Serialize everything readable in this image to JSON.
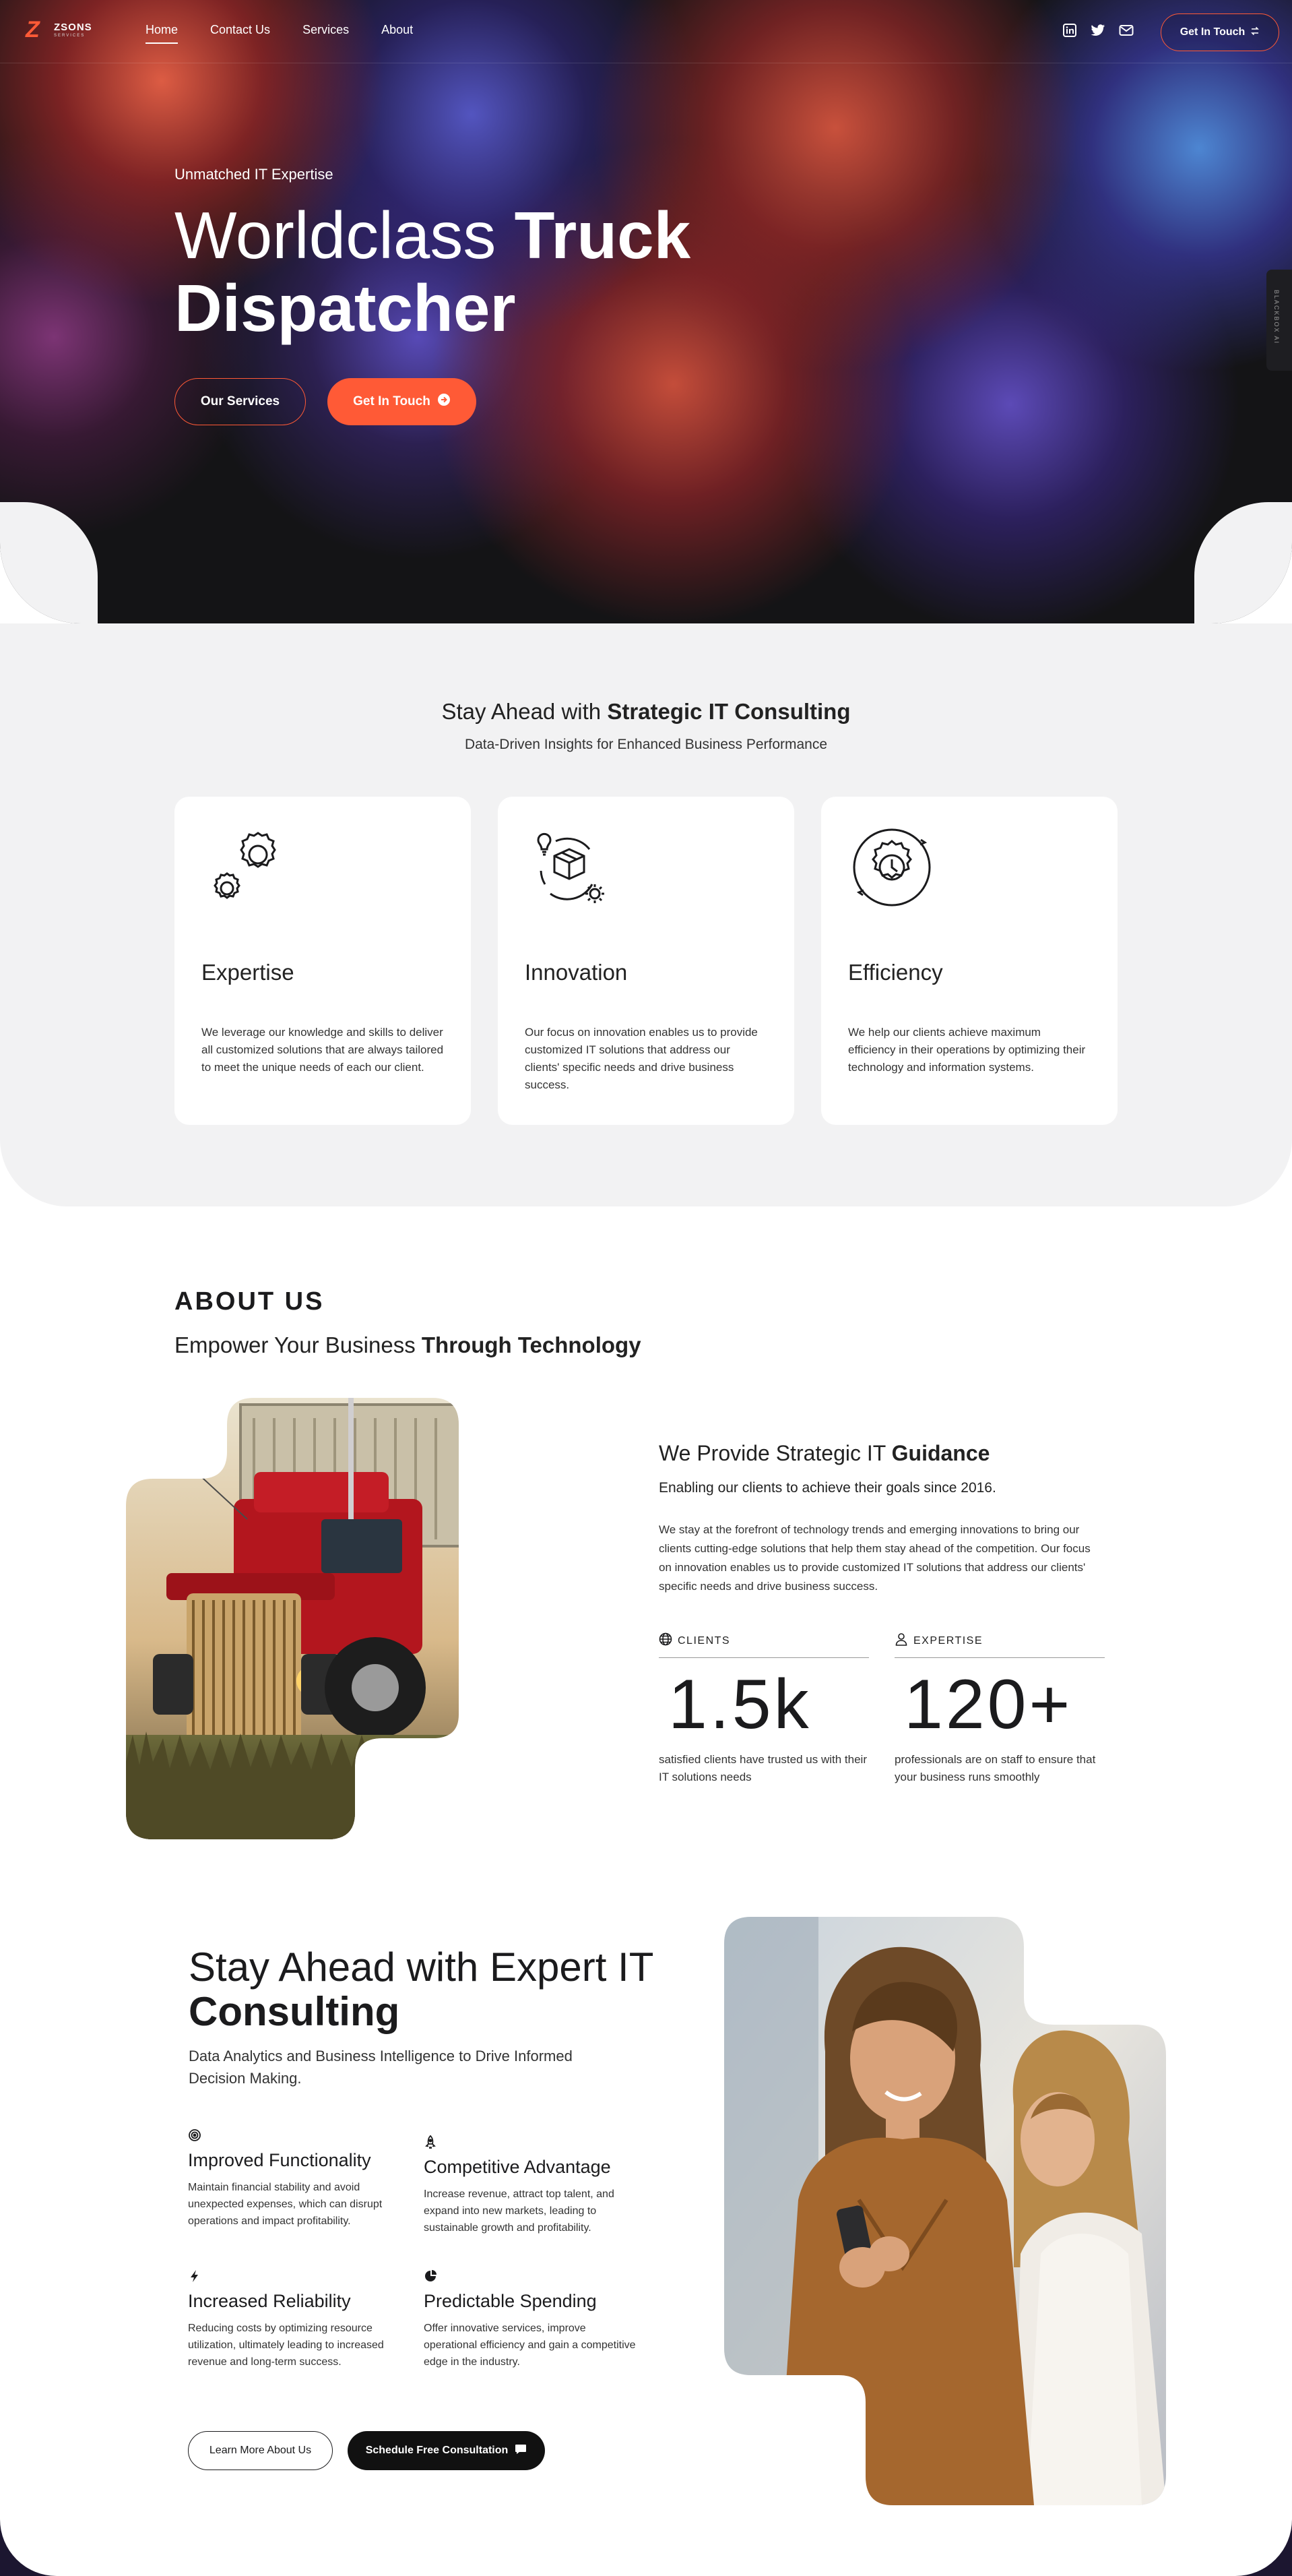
{
  "brand": {
    "name": "ZSONS",
    "tagline": "SERVICES"
  },
  "nav": {
    "links": [
      "Home",
      "Contact Us",
      "Services",
      "About"
    ],
    "active": "Home",
    "social": [
      "linkedin-icon",
      "twitter-icon",
      "mail-icon"
    ],
    "cta": "Get In Touch"
  },
  "hero": {
    "eyebrow": "Unmatched IT Expertise",
    "title_light": "Worldclass",
    "title_bold_1": "Truck",
    "title_bold_2": "Dispatcher",
    "btn_services": "Our Services",
    "btn_touch": "Get In Touch",
    "side_tab": "BLACKBOX AI"
  },
  "features": {
    "title_light": "Stay Ahead with",
    "title_bold": "Strategic IT Consulting",
    "subtitle": "Data-Driven Insights for Enhanced Business Performance",
    "cards": [
      {
        "title": "Expertise",
        "icon": "gears-icon",
        "text": "We leverage our knowledge and skills to deliver all customized solutions that are always tailored to meet the unique needs of each our client."
      },
      {
        "title": "Innovation",
        "icon": "innovation-box-icon",
        "text": "Our focus on innovation enables us to provide customized IT solutions that address our clients' specific needs and drive business success."
      },
      {
        "title": "Efficiency",
        "icon": "gear-clock-icon",
        "text": "We help our clients achieve maximum efficiency in their operations by optimizing their technology and information systems."
      }
    ]
  },
  "about": {
    "eyebrow": "ABOUT US",
    "title_light": "Empower Your Business",
    "title_bold": "Through Technology",
    "guide_title_light": "We Provide Strategic IT",
    "guide_title_bold": "Guidance",
    "guide_sub": "Enabling our clients to achieve their goals since 2016.",
    "guide_text": "We stay at the forefront of technology trends and emerging innovations to bring our clients cutting-edge solutions that help them stay ahead of the competition. Our focus on innovation enables us to provide customized IT solutions that address our clients' specific needs and drive business success.",
    "stats": [
      {
        "label": "CLIENTS",
        "icon": "globe-icon",
        "value": "1.5k",
        "desc": "satisfied clients have trusted us with their IT solutions needs"
      },
      {
        "label": "EXPERTISE",
        "icon": "user-icon",
        "value": "120+",
        "desc": "professionals are on staff to ensure that your business runs smoothly"
      }
    ]
  },
  "consulting": {
    "title_light": "Stay Ahead with Expert IT",
    "title_bold": "Consulting",
    "subtitle": "Data Analytics and Business Intelligence to Drive Informed Decision Making.",
    "benefits": [
      {
        "icon": "target-icon",
        "title": "Improved Functionality",
        "text": "Maintain financial stability and avoid unexpected expenses, which can disrupt operations and impact profitability."
      },
      {
        "icon": "rocket-icon",
        "title": "Competitive Advantage",
        "text": "Increase revenue, attract top talent, and expand into new markets, leading to sustainable growth and profitability."
      },
      {
        "icon": "bolt-icon",
        "title": "Increased Reliability",
        "text": "Reducing costs by optimizing resource utilization, ultimately leading to increased revenue and long-term success."
      },
      {
        "icon": "pie-chart-icon",
        "title": "Predictable Spending",
        "text": "Offer innovative services, improve operational efficiency and gain a competitive edge in the industry."
      }
    ],
    "btn_learn": "Learn More About Us",
    "btn_schedule": "Schedule Free Consultation"
  },
  "colors": {
    "accent": "#ff5a36",
    "dark": "#141416",
    "light_bg": "#f2f2f3"
  }
}
